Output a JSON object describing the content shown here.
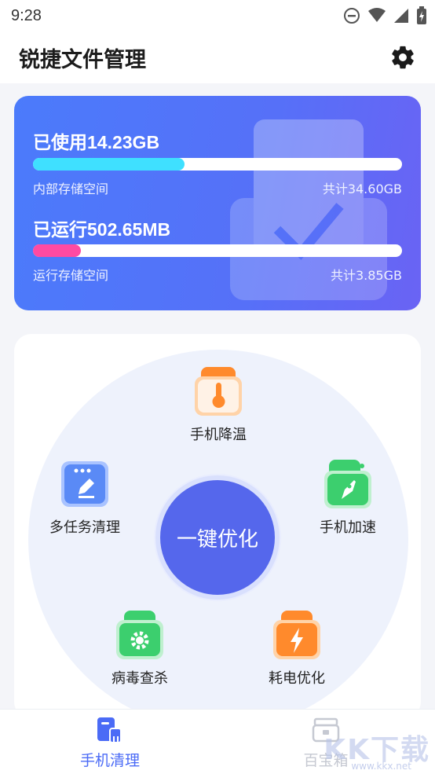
{
  "status_bar": {
    "time": "9:28"
  },
  "header": {
    "title": "锐捷文件管理",
    "settings_icon": "gear-icon"
  },
  "storage": {
    "internal": {
      "title": "已使用14.23GB",
      "label": "内部存储空间",
      "total": "共计34.60GB",
      "fraction": 0.41,
      "color": "#3fe0ff"
    },
    "running": {
      "title": "已运行502.65MB",
      "label": "运行存储空间",
      "total": "共计3.85GB",
      "fraction": 0.13,
      "color": "#ff4aa2"
    }
  },
  "tools": {
    "center_label": "一键优化",
    "cool": {
      "label": "手机降温",
      "icon": "thermometer-icon",
      "color": "#ff8a2c"
    },
    "multitask": {
      "label": "多任务清理",
      "icon": "edit-window-icon",
      "color": "#5a8af6"
    },
    "speed": {
      "label": "手机加速",
      "icon": "rocket-folder-icon",
      "color": "#3ccf6e"
    },
    "virus": {
      "label": "病毒查杀",
      "icon": "virus-gear-icon",
      "color": "#3ccf6e"
    },
    "power": {
      "label": "耗电优化",
      "icon": "lightning-icon",
      "color": "#ff8a2c"
    }
  },
  "bottom_nav": {
    "clean": {
      "label": "手机清理",
      "icon": "broom-phone-icon",
      "color": "#4b6bf6"
    },
    "box": {
      "label": "百宝箱",
      "icon": "treasure-box-icon",
      "color": "#c6c9d2"
    }
  },
  "watermark": {
    "text": "KK下载",
    "url": "www.kkx.net"
  }
}
